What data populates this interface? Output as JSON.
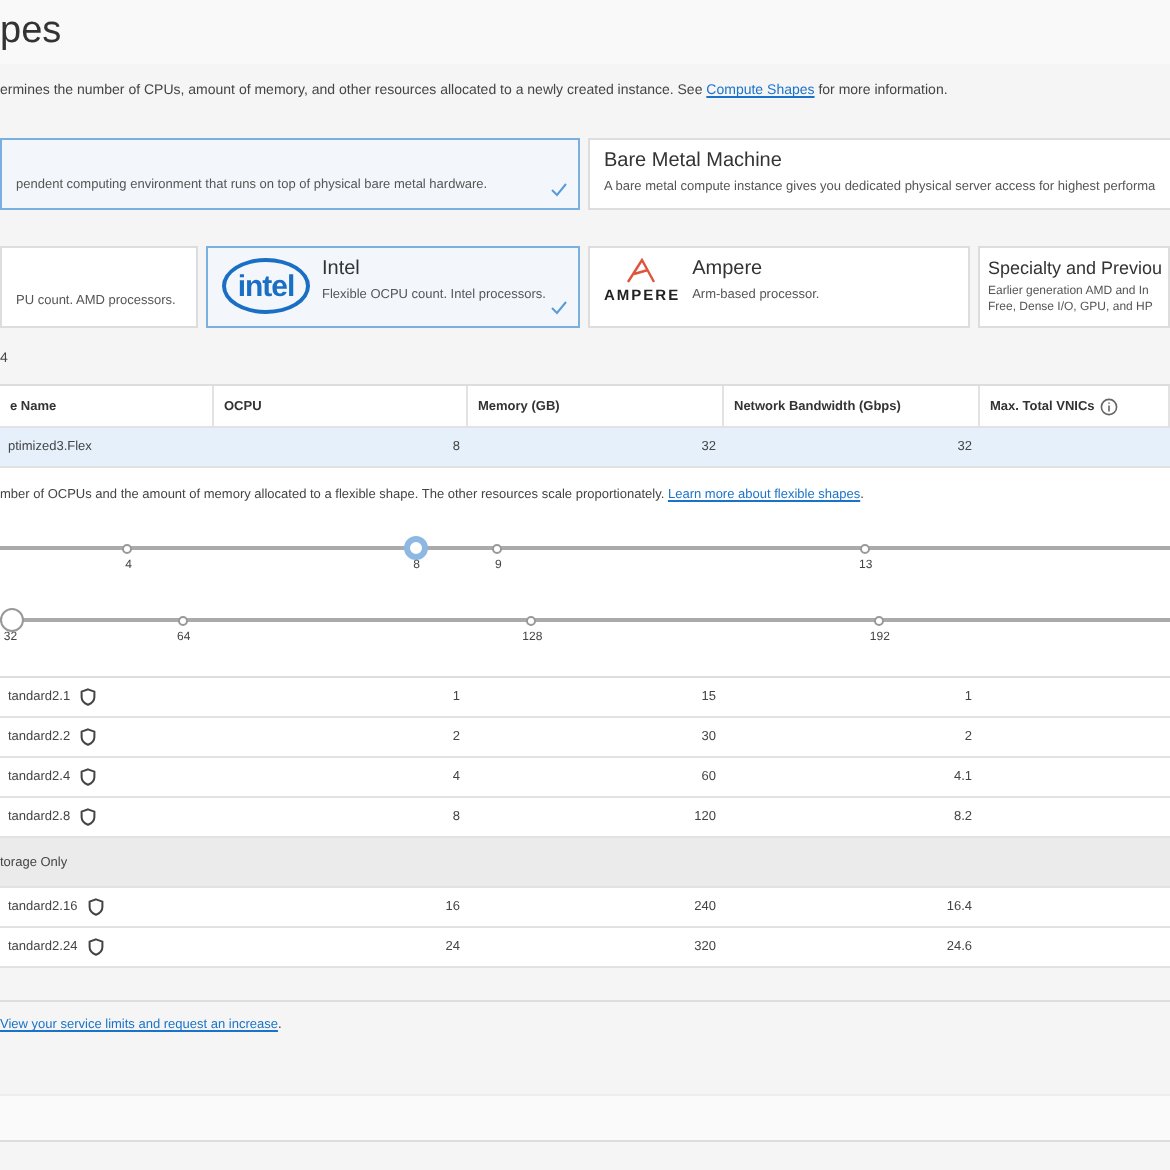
{
  "header": {
    "title": "pes"
  },
  "description": {
    "text": "ermines the number of CPUs, amount of memory, and other resources allocated to a newly created instance. See ",
    "link": "Compute Shapes",
    "after": " for more information."
  },
  "instance_types": [
    {
      "description": "pendent computing environment that runs on top of physical bare metal hardware.",
      "selected": true
    },
    {
      "title": "Bare Metal Machine",
      "description": "A bare metal compute instance gives you dedicated physical server access for highest performa",
      "selected": false
    }
  ],
  "processors": [
    {
      "kind": "plain",
      "description": "PU count. AMD processors.",
      "selected": false
    },
    {
      "kind": "intel",
      "logo": "intel",
      "title": "Intel",
      "description": "Flexible OCPU count. Intel processors.",
      "selected": true
    },
    {
      "kind": "ampere",
      "logo": "AMPERE",
      "title": "Ampere",
      "description": "Arm-based processor.",
      "selected": false
    },
    {
      "kind": "plain",
      "title": "Specialty and Previou",
      "description": "Earlier generation AMD and In\nFree, Dense I/O, GPU, and HP",
      "selected": false
    }
  ],
  "count_label": "4",
  "table": {
    "columns": [
      "e Name",
      "OCPU",
      "Memory (GB)",
      "Network Bandwidth (Gbps)",
      "Max. Total VNICs"
    ],
    "selected_row": {
      "name": "ptimized3.Flex",
      "ocpu": "8",
      "memory": "32",
      "bandwidth": "32",
      "selected": true
    },
    "flex_config": {
      "text": "mber of OCPUs and the amount of memory allocated to a flexible shape. The other resources scale proportionately. ",
      "link": "Learn more about flexible shapes",
      "after": ".",
      "sliders": [
        {
          "level": 0.356,
          "ticks": [
            "4",
            "8",
            "9",
            "13"
          ]
        },
        {
          "level": 0.011,
          "ticks": [
            "32",
            "64",
            "128",
            "192"
          ]
        }
      ]
    },
    "rows": [
      {
        "kind": "shape",
        "name": "tandard2.1",
        "ocpu": "1",
        "memory": "15",
        "bandwidth": "1"
      },
      {
        "kind": "shape",
        "name": "tandard2.2",
        "ocpu": "2",
        "memory": "30",
        "bandwidth": "2"
      },
      {
        "kind": "shape",
        "name": "tandard2.4",
        "ocpu": "4",
        "memory": "60",
        "bandwidth": "4.1"
      },
      {
        "kind": "shape",
        "name": "tandard2.8",
        "ocpu": "8",
        "memory": "120",
        "bandwidth": "8.2"
      },
      {
        "kind": "group",
        "name": "torage Only"
      },
      {
        "kind": "shape",
        "name": "tandard2.16",
        "ocpu": "16",
        "memory": "240",
        "bandwidth": "16.4"
      },
      {
        "kind": "shape",
        "name": "tandard2.24",
        "ocpu": "24",
        "memory": "320",
        "bandwidth": "24.6"
      }
    ]
  },
  "footer": {
    "link": "View your service limits and request an increase",
    "after": "."
  }
}
